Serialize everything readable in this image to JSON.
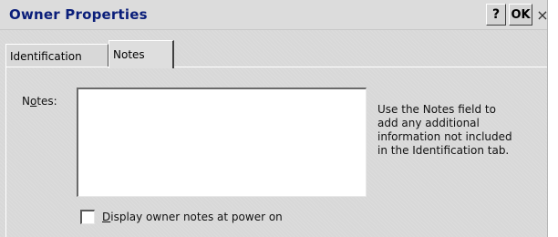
{
  "window": {
    "title": "Owner Properties",
    "help_button": "?",
    "ok_button": "OK",
    "close_button": "×"
  },
  "tabs": [
    {
      "label": "Identification",
      "active": false
    },
    {
      "label": "Notes",
      "active": true
    }
  ],
  "notes": {
    "label_pre": "N",
    "label_mnemonic": "o",
    "label_post": "tes:",
    "value": "",
    "help_lines": [
      "Use the Notes field to",
      "add any additional",
      "information not included",
      "in the Identification tab."
    ]
  },
  "display_on_power_on": {
    "label_mnemonic": "D",
    "label_rest": "isplay owner notes at power on",
    "checked": false
  },
  "colors": {
    "title_text": "#0a1e7a",
    "background": "#d8d8d8"
  }
}
